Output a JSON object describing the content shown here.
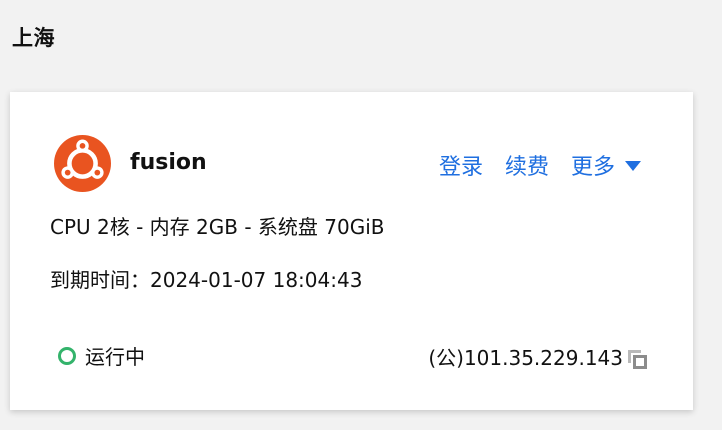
{
  "region": {
    "title": "上海"
  },
  "instance": {
    "name": "fusion",
    "os_icon": "ubuntu-logo-icon",
    "spec": "CPU 2核 - 内存 2GB - 系统盘 70GiB",
    "expire_label": "到期时间：",
    "expire_value": "2024-01-07 18:04:43",
    "status_text": "运行中",
    "status_color": "#33b36b",
    "ip_text": "(公)101.35.229.143"
  },
  "actions": {
    "login_label": "登录",
    "renew_label": "续费",
    "more_label": "更多",
    "color": "#1f6fe0"
  },
  "brand": {
    "ubuntu_color": "#e95420"
  }
}
